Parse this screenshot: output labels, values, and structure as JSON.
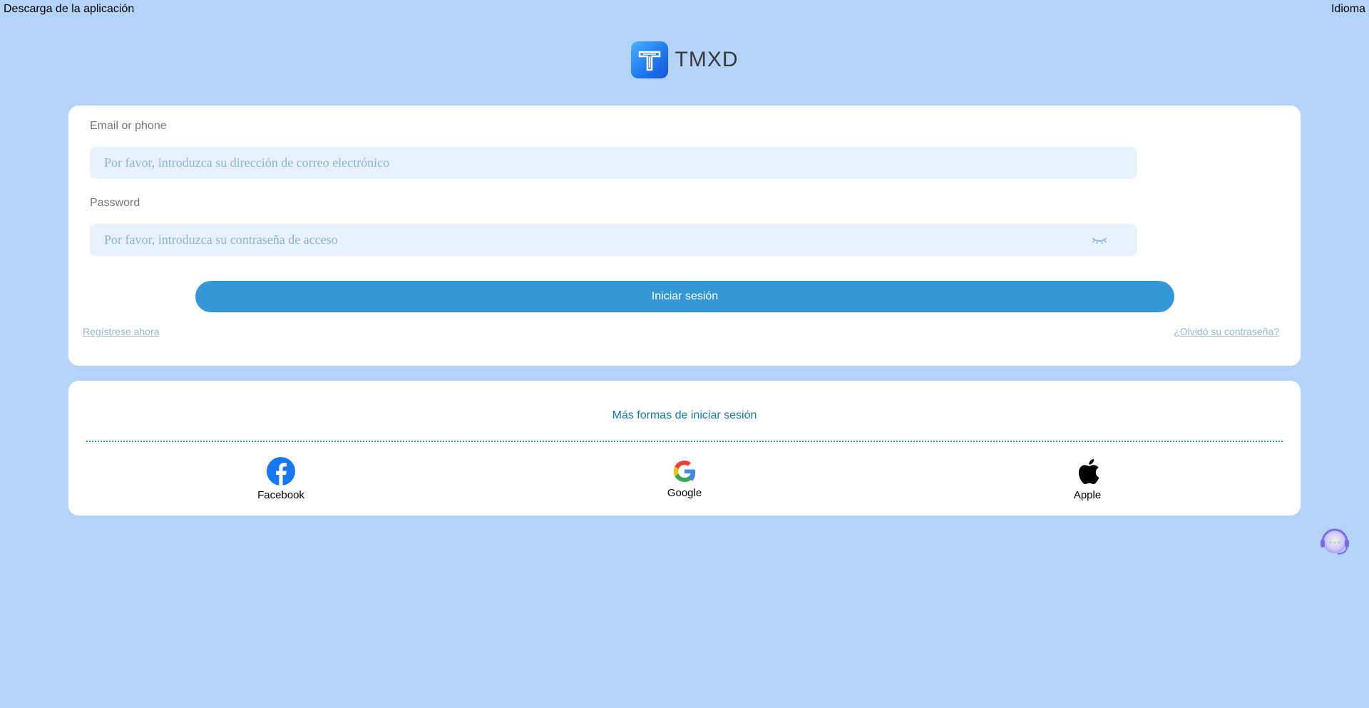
{
  "header": {
    "download_link": "Descarga de la aplicación",
    "language_link": "Idioma"
  },
  "brand": {
    "name": "TMXD",
    "logo_icon": "tmxd-logo-icon",
    "accent_color": "#1f7af0"
  },
  "login": {
    "email_label": "Email or phone",
    "email_placeholder": "Por favor, introduzca su dirección de correo electrónico",
    "email_value": "",
    "password_label": "Password",
    "password_placeholder": "Por favor, introduzca su contraseña de acceso",
    "password_value": "",
    "password_toggle_icon": "eye-closed-icon",
    "submit_label": "Iniciar sesión",
    "submit_color": "#3598d6",
    "register_link": "Regístrese ahora",
    "forgot_link": "¿Olvidó su contraseña?"
  },
  "social": {
    "title": "Más formas de iniciar sesión",
    "providers": [
      {
        "label": "Facebook",
        "icon": "facebook-icon",
        "color": "#1877f2"
      },
      {
        "label": "Google",
        "icon": "google-icon",
        "color": "#4285f4"
      },
      {
        "label": "Apple",
        "icon": "apple-icon",
        "color": "#000000"
      }
    ]
  },
  "support": {
    "icon": "customer-support-icon"
  },
  "colors": {
    "page_background": "#b4d3f8",
    "card_background": "#ffffff",
    "input_background": "#e7f2fe"
  }
}
